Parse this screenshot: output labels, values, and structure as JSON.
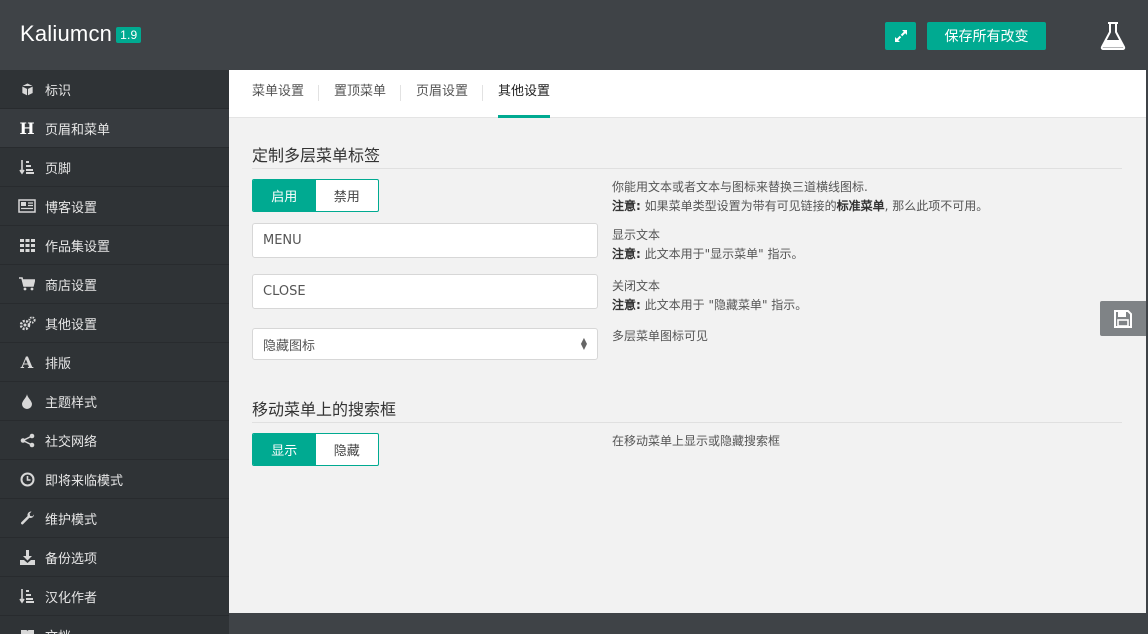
{
  "header": {
    "brand": "Kaliumcn",
    "version": "1.9",
    "save_all_label": "保存所有改变"
  },
  "colors": {
    "accent": "#00aa91",
    "sidebar_bg": "#2f3336",
    "header_bg": "#3f4347"
  },
  "sidebar": {
    "items": [
      {
        "label": "标识",
        "icon": "cube-icon"
      },
      {
        "label": "页眉和菜单",
        "icon": "header-icon"
      },
      {
        "label": "页脚",
        "icon": "sort-amount-icon"
      },
      {
        "label": "博客设置",
        "icon": "newspaper-icon"
      },
      {
        "label": "作品集设置",
        "icon": "grid-icon"
      },
      {
        "label": "商店设置",
        "icon": "cart-icon"
      },
      {
        "label": "其他设置",
        "icon": "gears-icon"
      },
      {
        "label": "排版",
        "icon": "font-icon"
      },
      {
        "label": "主题样式",
        "icon": "tint-icon"
      },
      {
        "label": "社交网络",
        "icon": "share-icon"
      },
      {
        "label": "即将来临模式",
        "icon": "clock-icon"
      },
      {
        "label": "维护模式",
        "icon": "wrench-icon"
      },
      {
        "label": "备份选项",
        "icon": "download-icon"
      },
      {
        "label": "汉化作者",
        "icon": "sort-amount-icon"
      },
      {
        "label": "文档",
        "icon": "book-icon"
      }
    ]
  },
  "tabs": [
    {
      "label": "菜单设置"
    },
    {
      "label": "置顶菜单"
    },
    {
      "label": "页眉设置"
    },
    {
      "label": "其他设置"
    }
  ],
  "section1": {
    "title": "定制多层菜单标签",
    "toggle_on": "启用",
    "toggle_off": "禁用",
    "desc_line1": "你能用文本或者文本与图标来替换三道横线图标.",
    "note_label": "注意:",
    "note_text_pre": "如果菜单类型设置为带有可见链接的",
    "note_bold": "标准菜单",
    "note_text_post": ", 那么此项不可用。",
    "open_text_value": "MENU",
    "open_text_label": "显示文本",
    "open_text_note": "此文本用于\"显示菜单\" 指示。",
    "close_text_value": "CLOSE",
    "close_text_label": "关闭文本",
    "close_text_note": "此文本用于 \"隐藏菜单\" 指示。",
    "icon_select_value": "隐藏图标",
    "icon_select_label": "多层菜单图标可见"
  },
  "section2": {
    "title": "移动菜单上的搜索框",
    "toggle_on": "显示",
    "toggle_off": "隐藏",
    "desc": "在移动菜单上显示或隐藏搜索框"
  }
}
